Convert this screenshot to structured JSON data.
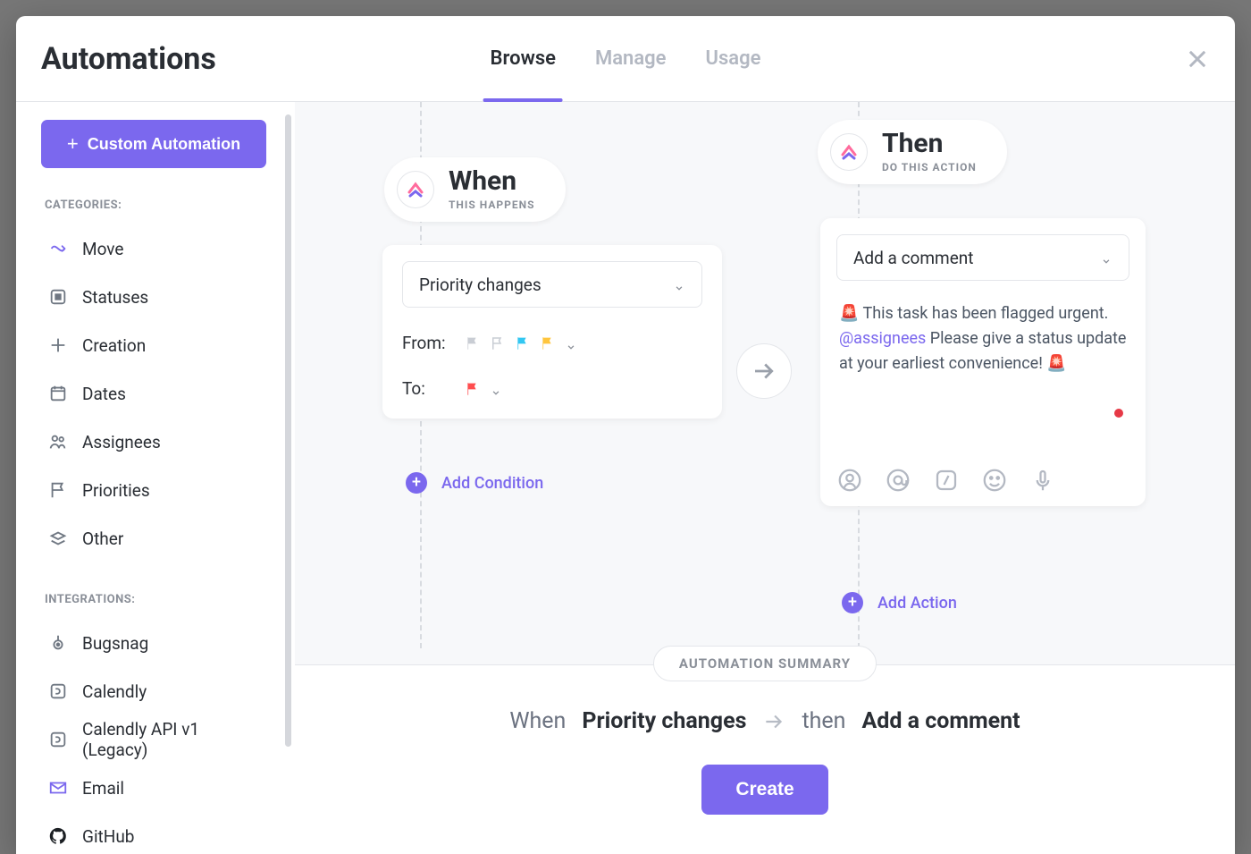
{
  "header": {
    "title": "Automations",
    "tabs": [
      "Browse",
      "Manage",
      "Usage"
    ],
    "active_tab": "Browse"
  },
  "sidebar": {
    "custom_button": "Custom Automation",
    "categories_label": "CATEGORIES:",
    "categories": [
      {
        "icon": "move",
        "label": "Move"
      },
      {
        "icon": "status",
        "label": "Statuses"
      },
      {
        "icon": "creation",
        "label": "Creation"
      },
      {
        "icon": "dates",
        "label": "Dates"
      },
      {
        "icon": "assignees",
        "label": "Assignees"
      },
      {
        "icon": "priorities",
        "label": "Priorities"
      },
      {
        "icon": "other",
        "label": "Other"
      }
    ],
    "integrations_label": "INTEGRATIONS:",
    "integrations": [
      {
        "icon": "bugsnag",
        "label": "Bugsnag"
      },
      {
        "icon": "calendly",
        "label": "Calendly"
      },
      {
        "icon": "calendly",
        "label": "Calendly API v1 (Legacy)"
      },
      {
        "icon": "email",
        "label": "Email"
      },
      {
        "icon": "github",
        "label": "GitHub"
      }
    ]
  },
  "when": {
    "title": "When",
    "subtitle": "THIS HAPPENS",
    "trigger": "Priority changes",
    "from_label": "From:",
    "from_flags": [
      "#c9cdd4",
      "#c9cdd4",
      "#33c7f2",
      "#ffc53d"
    ],
    "to_label": "To:",
    "to_flags": [
      "#ff4d4f"
    ],
    "add_condition": "Add Condition"
  },
  "then": {
    "title": "Then",
    "subtitle": "DO THIS ACTION",
    "action": "Add a comment",
    "comment_pre": "🚨 This task has been flagged urgent. ",
    "comment_mention": "@assignees",
    "comment_post": " Please give a status update at your earliest convenience! 🚨",
    "add_action": "Add Action"
  },
  "summary": {
    "label": "AUTOMATION SUMMARY",
    "when_word": "When",
    "when_value": "Priority changes",
    "then_word": "then",
    "then_value": "Add a comment",
    "create": "Create"
  }
}
